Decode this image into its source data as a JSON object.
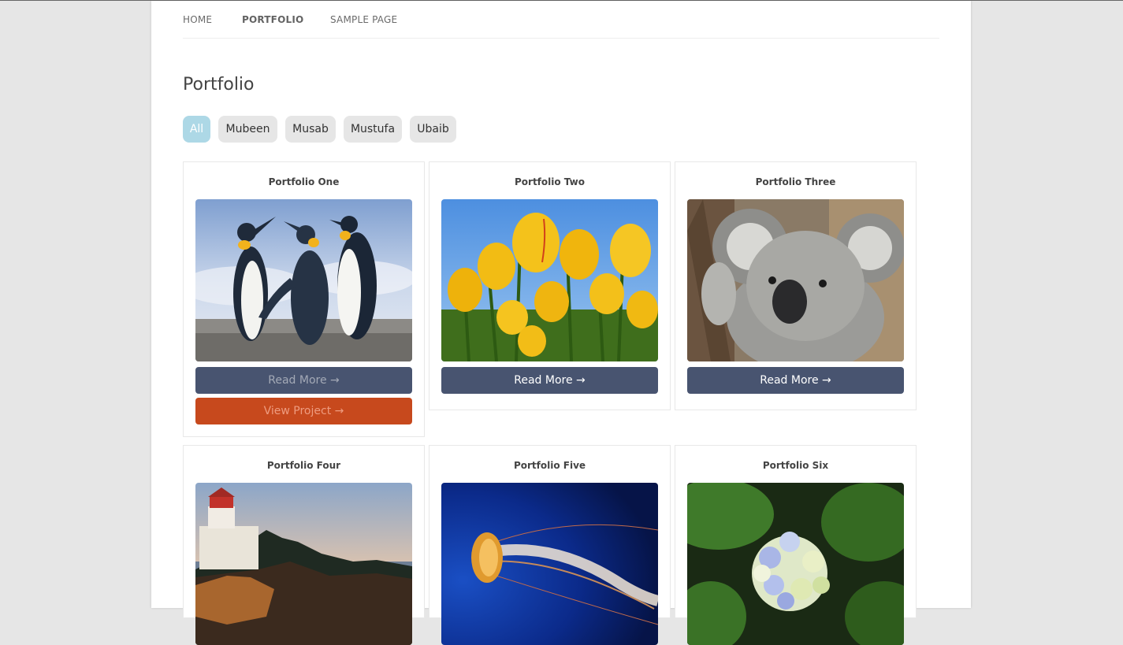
{
  "nav": [
    {
      "label": "HOME",
      "active": false
    },
    {
      "label": "PORTFOLIO",
      "active": true
    },
    {
      "label": "SAMPLE PAGE",
      "active": false
    }
  ],
  "page_title": "Portfolio",
  "filters": [
    {
      "label": "All",
      "active": true
    },
    {
      "label": "Mubeen",
      "active": false
    },
    {
      "label": "Musab",
      "active": false
    },
    {
      "label": "Mustufa",
      "active": false
    },
    {
      "label": "Ubaib",
      "active": false
    }
  ],
  "portfolio": [
    {
      "title": "Portfolio One",
      "image": "penguins-photo",
      "read_more": "Read More →",
      "view_project": "View Project →"
    },
    {
      "title": "Portfolio Two",
      "image": "tulips-photo",
      "read_more": "Read More →"
    },
    {
      "title": "Portfolio Three",
      "image": "koala-photo",
      "read_more": "Read More →"
    },
    {
      "title": "Portfolio Four",
      "image": "lighthouse-photo"
    },
    {
      "title": "Portfolio Five",
      "image": "jellyfish-photo"
    },
    {
      "title": "Portfolio Six",
      "image": "hydrangea-photo"
    }
  ],
  "colors": {
    "filter_active": "#add8e6",
    "read_more_button": "#485470",
    "view_project_button": "#c7491d"
  }
}
